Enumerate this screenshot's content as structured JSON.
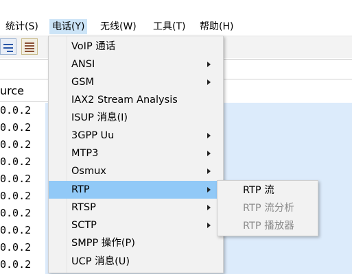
{
  "menubar": {
    "items": [
      {
        "label": "统计(S)"
      },
      {
        "label": "电话(Y)"
      },
      {
        "label": "无线(W)"
      },
      {
        "label": "工具(T)"
      },
      {
        "label": "帮助(H)"
      }
    ]
  },
  "packet_list": {
    "column_header": "urce",
    "rows": [
      "0.0.2",
      "0.0.2",
      "0.0.2",
      "0.0.2",
      "0.0.2",
      "0.0.2",
      "0.0.2",
      "0.0.2",
      "0.0.2",
      "0.0.2"
    ],
    "row_color": "#dcebfb"
  },
  "telephony_menu": {
    "items": [
      {
        "label": "VoIP 通话",
        "submenu": false
      },
      {
        "label": "ANSI",
        "submenu": true
      },
      {
        "label": "GSM",
        "submenu": true
      },
      {
        "label": "IAX2 Stream Analysis",
        "submenu": false
      },
      {
        "label": "ISUP 消息(I)",
        "submenu": false
      },
      {
        "label": "3GPP Uu",
        "submenu": true
      },
      {
        "label": "MTP3",
        "submenu": true
      },
      {
        "label": "Osmux",
        "submenu": true
      },
      {
        "label": "RTP",
        "submenu": true,
        "highlighted": true
      },
      {
        "label": "RTSP",
        "submenu": true
      },
      {
        "label": "SCTP",
        "submenu": true
      },
      {
        "label": "SMPP 操作(P)",
        "submenu": false
      },
      {
        "label": "UCP 消息(U)",
        "submenu": false
      }
    ],
    "highlight_color": "#91c9f7"
  },
  "rtp_submenu": {
    "items": [
      {
        "label": "RTP 流",
        "enabled": true
      },
      {
        "label": "RTP 流分析",
        "enabled": false
      },
      {
        "label": "RTP 播放器",
        "enabled": false
      }
    ]
  }
}
